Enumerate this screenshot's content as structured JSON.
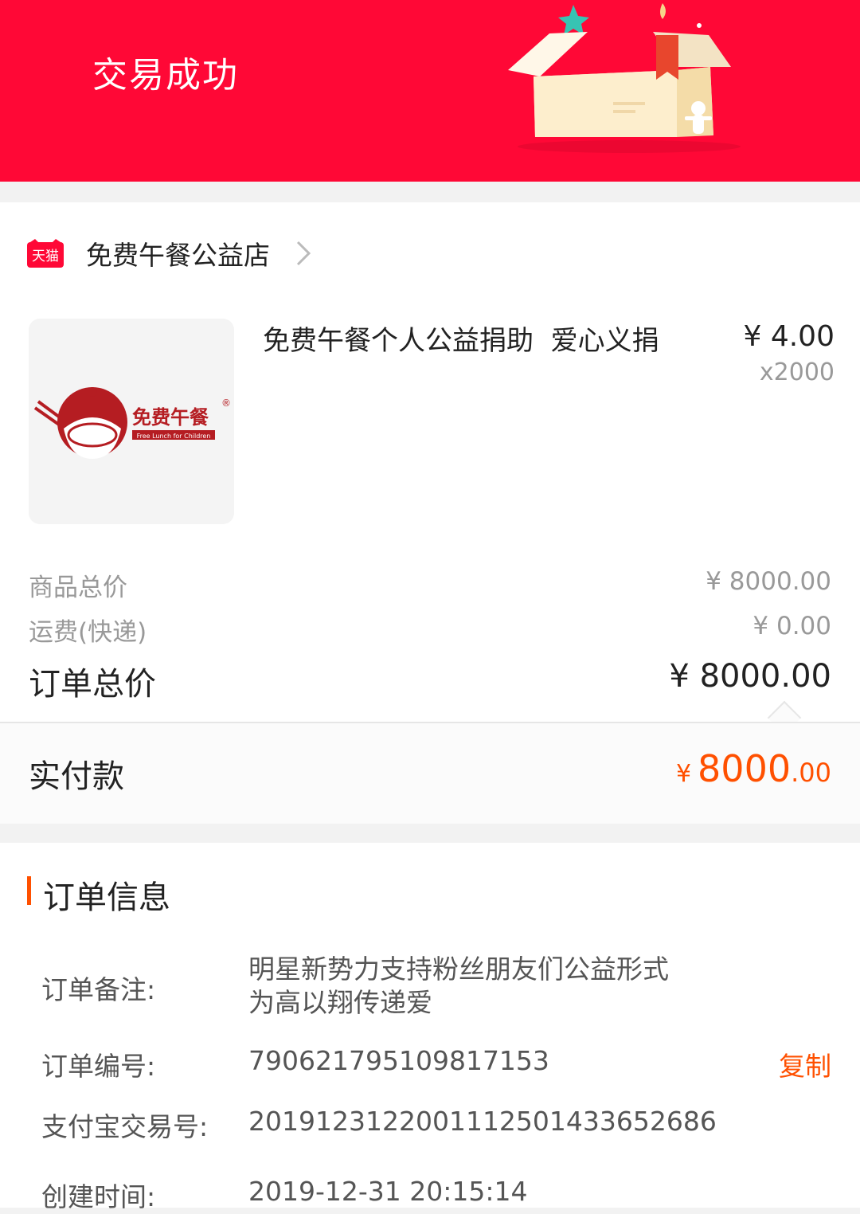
{
  "header": {
    "title": "交易成功"
  },
  "shop": {
    "badge": "天猫",
    "name": "免费午餐公益店"
  },
  "product": {
    "logo_text": "免费午餐",
    "logo_subtext": "Free Lunch for Children",
    "title": "免费午餐个人公益捐助  爱心义捐",
    "price": "¥ 4.00",
    "quantity": "x2000"
  },
  "summary": {
    "subtotal_label": "商品总价",
    "subtotal_value": "¥ 8000.00",
    "shipping_label": "运费(快递)",
    "shipping_value": "¥ 0.00",
    "total_label": "订单总价",
    "total_value": "¥ 8000.00"
  },
  "payment": {
    "label": "实付款",
    "currency": "¥",
    "amount_int": "8000",
    "amount_dec": ".00"
  },
  "order_info": {
    "title": "订单信息",
    "note_label": "订单备注:",
    "note_line1": "明星新势力支持粉丝朋友们公益形式",
    "note_line2": "为高以翔传递爱",
    "order_no_label": "订单编号:",
    "order_no": "790621795109817153",
    "copy_label": "复制",
    "alipay_label": "支付宝交易号:",
    "alipay_no": "2019123122001112501433652686",
    "created_label": "创建时间:",
    "created_time": "2019-12-31 20:15:14"
  },
  "colors": {
    "header_red": "#ff0836",
    "accent_orange": "#ff5000"
  }
}
